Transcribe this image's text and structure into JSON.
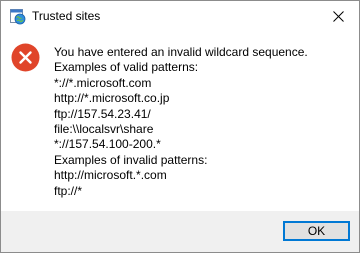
{
  "window": {
    "title": "Trusted sites",
    "icon": "internet-options-icon",
    "close_icon": "close-icon"
  },
  "error_icon": {
    "name": "error-icon",
    "color": "#e0452a"
  },
  "message": {
    "lines": [
      "You have entered an invalid wildcard sequence.",
      "Examples of valid patterns:",
      "*://*.microsoft.com",
      "http://*.microsoft.co.jp",
      "ftp://157.54.23.41/",
      "file:\\\\localsvr\\share",
      "*://157.54.100-200.*",
      "Examples of invalid patterns:",
      "http://microsoft.*.com",
      "ftp://*"
    ]
  },
  "buttons": {
    "ok_label": "OK"
  }
}
